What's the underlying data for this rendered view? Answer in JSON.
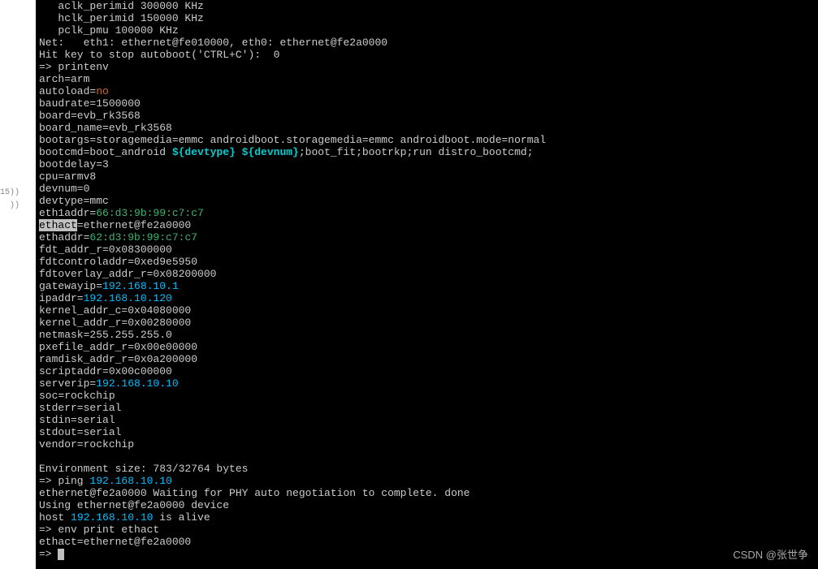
{
  "sidebar": {
    "line1": "15))",
    "line2": "))"
  },
  "term": {
    "clk1": "   aclk_perimid 300000 KHz",
    "clk2": "   hclk_perimid 150000 KHz",
    "clk3": "   pclk_pmu 100000 KHz",
    "net": "Net:   eth1: ethernet@fe010000, eth0: ethernet@fe2a0000",
    "hitkey": "Hit key to stop autoboot('CTRL+C'):  0",
    "prompt_printenv": "=> printenv",
    "arch": "arch=arm",
    "autoload_key": "autoload=",
    "autoload_val": "no",
    "baudrate": "baudrate=1500000",
    "board": "board=evb_rk3568",
    "board_name": "board_name=evb_rk3568",
    "bootargs": "bootargs=storagemedia=emmc androidboot.storagemedia=emmc androidboot.mode=normal",
    "bootcmd_key": "bootcmd=boot_android ",
    "bootcmd_vars": "${devtype} ${devnum}",
    "bootcmd_rest": ";boot_fit;bootrkp;run distro_bootcmd;",
    "bootdelay": "bootdelay=3",
    "cpu": "cpu=armv8",
    "devnum": "devnum=0",
    "devtype": "devtype=mmc",
    "eth1addr_key": "eth1addr=",
    "eth1addr_val": "66:d3:9b:99:c7:c7",
    "ethact_key": "ethact",
    "ethact_rest": "=ethernet@fe2a0000",
    "ethaddr_key": "ethaddr=",
    "ethaddr_val": "62:d3:9b:99:c7:c7",
    "fdt_addr_r": "fdt_addr_r=0x08300000",
    "fdtcontroladdr": "fdtcontroladdr=0xed9e5950",
    "fdtoverlay": "fdtoverlay_addr_r=0x08200000",
    "gatewayip_key": "gatewayip=",
    "gatewayip_val": "192.168.10.1",
    "ipaddr_key": "ipaddr=",
    "ipaddr_val": "192.168.10.120",
    "kernel_addr_c": "kernel_addr_c=0x04080000",
    "kernel_addr_r": "kernel_addr_r=0x00280000",
    "netmask": "netmask=255.255.255.0",
    "pxefile": "pxefile_addr_r=0x00e00000",
    "ramdisk": "ramdisk_addr_r=0x0a200000",
    "scriptaddr": "scriptaddr=0x00c00000",
    "serverip_key": "serverip=",
    "serverip_val": "192.168.10.10",
    "soc": "soc=rockchip",
    "stderr": "stderr=serial",
    "stdin": "stdin=serial",
    "stdout": "stdout=serial",
    "vendor": "vendor=rockchip",
    "blank": "",
    "envsize": "Environment size: 783/32764 bytes",
    "ping_prompt": "=> ping ",
    "ping_ip": "192.168.10.10",
    "phy": "ethernet@fe2a0000 Waiting for PHY auto negotiation to complete. done",
    "using": "Using ethernet@fe2a0000 device",
    "host_pre": "host ",
    "host_ip": "192.168.10.10",
    "host_post": " is alive",
    "envprint": "=> env print ethact",
    "ethact_out": "ethact=ethernet@fe2a0000",
    "last_prompt": "=> "
  },
  "watermark": "CSDN @张世争"
}
